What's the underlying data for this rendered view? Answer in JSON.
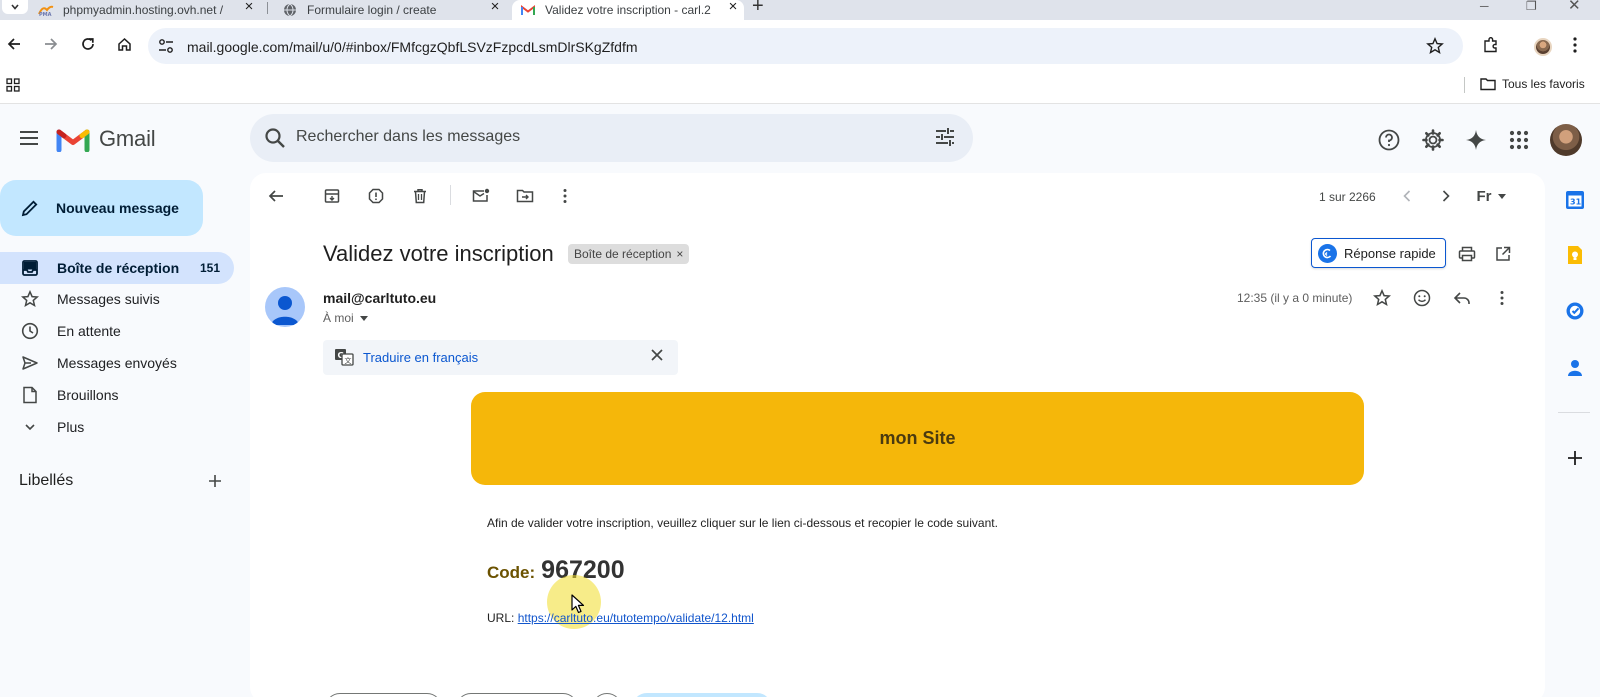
{
  "browser": {
    "tabs": [
      {
        "title": "phpmyadmin.hosting.ovh.net /",
        "favicon": "phpmyadmin-icon",
        "active": false
      },
      {
        "title": "Formulaire login / create",
        "favicon": "globe-icon",
        "active": false
      },
      {
        "title": "Validez votre inscription - carl.2",
        "favicon": "gmail-icon",
        "active": true
      }
    ],
    "url": "mail.google.com/mail/u/0/#inbox/FMfcgzQbfLSVzFzpcdLsmDlrSKgZfdfm",
    "bookmarks_folder": "Tous les favoris"
  },
  "gmail": {
    "brand": "Gmail",
    "search_placeholder": "Rechercher dans les messages",
    "compose_label": "Nouveau message",
    "nav": [
      {
        "label": "Boîte de réception",
        "count": "151",
        "icon": "inbox-icon",
        "active": true
      },
      {
        "label": "Messages suivis",
        "count": "",
        "icon": "star-icon",
        "active": false
      },
      {
        "label": "En attente",
        "count": "",
        "icon": "clock-icon",
        "active": false
      },
      {
        "label": "Messages envoyés",
        "count": "",
        "icon": "send-icon",
        "active": false
      },
      {
        "label": "Brouillons",
        "count": "",
        "icon": "draft-icon",
        "active": false
      },
      {
        "label": "Plus",
        "count": "",
        "icon": "chevron-down-icon",
        "active": false
      }
    ],
    "labels_title": "Libellés",
    "pager": "1 sur 2266",
    "input_tool": "Fr"
  },
  "message": {
    "subject": "Validez votre inscription",
    "label_chip": "Boîte de réception",
    "quick_reply": "Réponse rapide",
    "sender": "mail@carltuto.eu",
    "to": "À moi",
    "time": "12:35 (il y a 0 minute)",
    "translate": "Traduire en français",
    "banner_title": "mon Site",
    "body": "Afin de valider votre inscription, veuillez cliquer sur le lien ci-dessous et recopier le code suivant.",
    "code_label": "Code:",
    "code_value": "967200",
    "url_label": "URL:",
    "url": "https://carltuto.eu/tutotempo/validate/12.html"
  },
  "colors": {
    "banner": "#f5b70a",
    "compose": "#c2e7ff",
    "nav_active": "#d3e3fd",
    "link": "#1155cc"
  }
}
